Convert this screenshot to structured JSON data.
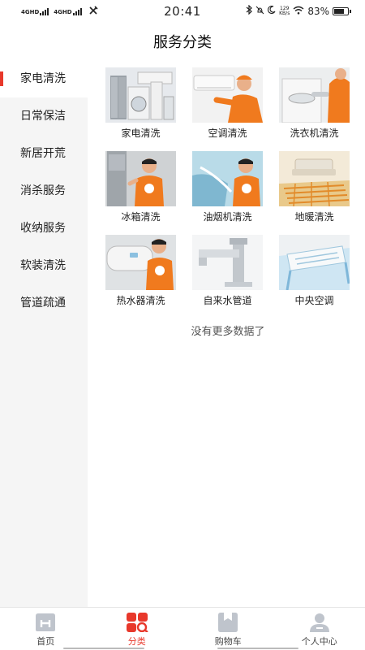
{
  "status_bar": {
    "network_1": "4GHD",
    "network_2": "4GHD",
    "time": "20:41",
    "net_speed_value": "129",
    "net_speed_unit": "KB/s",
    "battery_percent": "83%",
    "battery_level": 0.83
  },
  "header": {
    "title": "服务分类"
  },
  "sidebar": {
    "items": [
      {
        "label": "家电清洗",
        "active": true
      },
      {
        "label": "日常保洁"
      },
      {
        "label": "新居开荒"
      },
      {
        "label": "消杀服务"
      },
      {
        "label": "收纳服务"
      },
      {
        "label": "软装清洗"
      },
      {
        "label": "管道疏通"
      }
    ]
  },
  "grid": {
    "items": [
      {
        "label": "家电清洗"
      },
      {
        "label": "空调清洗"
      },
      {
        "label": "洗衣机清洗"
      },
      {
        "label": "冰箱清洗"
      },
      {
        "label": "油烟机清洗"
      },
      {
        "label": "地暖清洗"
      },
      {
        "label": "热水器清洗"
      },
      {
        "label": "自来水管道"
      },
      {
        "label": "中央空调"
      }
    ]
  },
  "footer_note": "没有更多数据了",
  "tabbar": {
    "items": [
      {
        "label": "首页",
        "icon": "home-icon"
      },
      {
        "label": "分类",
        "icon": "category-icon",
        "active": true
      },
      {
        "label": "购物车",
        "icon": "cart-icon"
      },
      {
        "label": "个人中心",
        "icon": "profile-icon"
      }
    ]
  },
  "colors": {
    "accent": "#e8382b",
    "sidebar_bg": "#f5f5f5",
    "tab_icon_gray": "#bfc4cc"
  }
}
